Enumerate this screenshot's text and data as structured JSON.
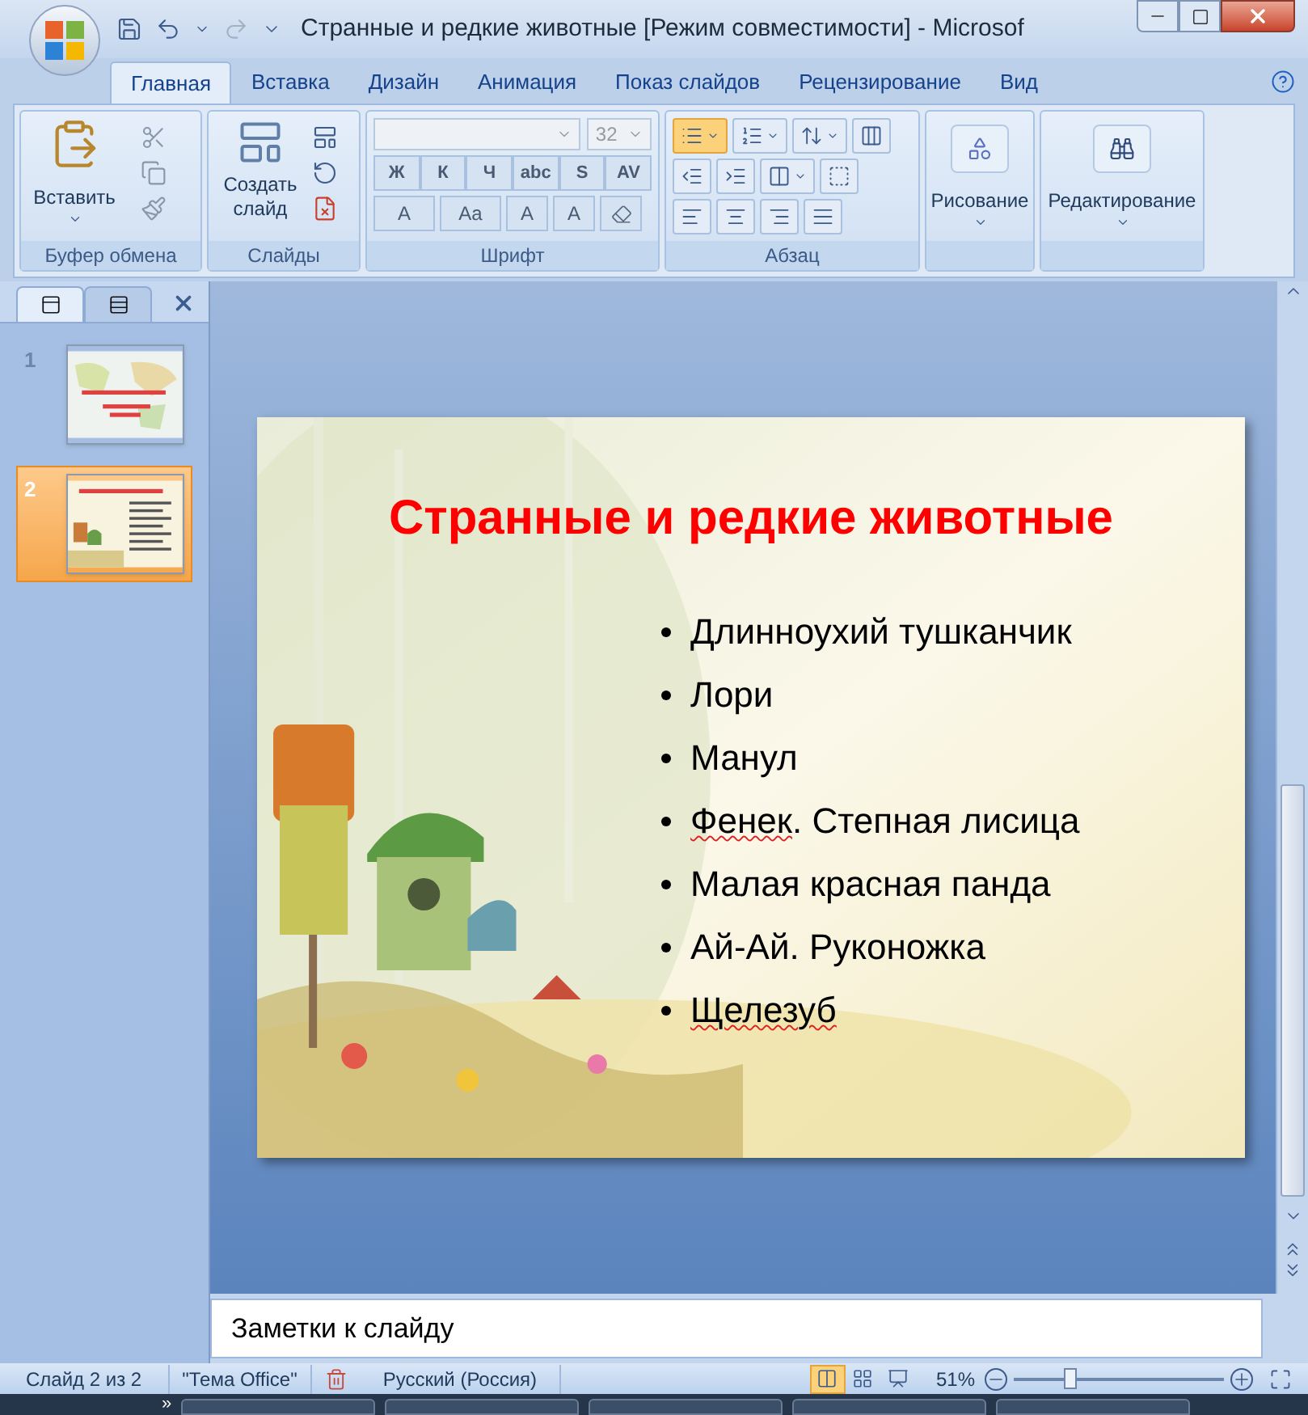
{
  "window": {
    "title": "Странные и редкие животные [Режим совместимости] - Microsof"
  },
  "tabs": [
    {
      "label": "Главная",
      "selected": true
    },
    {
      "label": "Вставка",
      "selected": false
    },
    {
      "label": "Дизайн",
      "selected": false
    },
    {
      "label": "Анимация",
      "selected": false
    },
    {
      "label": "Показ слайдов",
      "selected": false
    },
    {
      "label": "Рецензирование",
      "selected": false
    },
    {
      "label": "Вид",
      "selected": false
    }
  ],
  "ribbon": {
    "clipboard": {
      "label": "Буфер обмена",
      "paste": "Вставить"
    },
    "slides": {
      "label": "Слайды",
      "new_slide": "Создать слайд"
    },
    "font": {
      "label": "Шрифт",
      "size": "32",
      "buttons": [
        "Ж",
        "К",
        "Ч",
        "abc",
        "S",
        "AV"
      ],
      "buttons2": [
        "A",
        "Aa",
        "A",
        "A"
      ]
    },
    "paragraph": {
      "label": "Абзац",
      "bullets": {
        "selected": true
      },
      "numbering": {
        "selected": false
      }
    },
    "drawing": {
      "label": "Рисование"
    },
    "editing": {
      "label": "Редактирование"
    }
  },
  "pane_tabs": [
    {
      "kind": "slides",
      "selected": true
    },
    {
      "kind": "outline",
      "selected": false
    }
  ],
  "thumbnails": [
    {
      "number": "1",
      "selected": false,
      "kind": "map"
    },
    {
      "number": "2",
      "selected": true,
      "kind": "garden"
    }
  ],
  "slide": {
    "title": "Странные и редкие животные",
    "bullets": [
      {
        "segments": [
          {
            "text": "Длинноухий тушканчик",
            "misspelled": false
          }
        ]
      },
      {
        "segments": [
          {
            "text": "Лори",
            "misspelled": false
          }
        ]
      },
      {
        "segments": [
          {
            "text": "Манул",
            "misspelled": false
          }
        ]
      },
      {
        "segments": [
          {
            "text": "Фенек",
            "misspelled": true
          },
          {
            "text": ". Степная лисица",
            "misspelled": false
          }
        ]
      },
      {
        "segments": [
          {
            "text": "Малая красная панда",
            "misspelled": false
          }
        ]
      },
      {
        "segments": [
          {
            "text": "Ай-Ай. Руконожка",
            "misspelled": false
          }
        ]
      },
      {
        "segments": [
          {
            "text": "Щелезуб",
            "misspelled": true
          }
        ]
      }
    ]
  },
  "notes": {
    "text": "Заметки к слайду"
  },
  "status_bar": {
    "slide": "Слайд 2 из 2",
    "theme": "\"Тема Office\"",
    "language": "Русский (Россия)",
    "zoom": "51%",
    "zoom_slider": {
      "level": 0.27
    },
    "views": [
      {
        "kind": "normal",
        "selected": true
      },
      {
        "kind": "sorter",
        "selected": false
      },
      {
        "kind": "show",
        "selected": false
      }
    ]
  },
  "taskbar": {
    "overflow": "»"
  }
}
